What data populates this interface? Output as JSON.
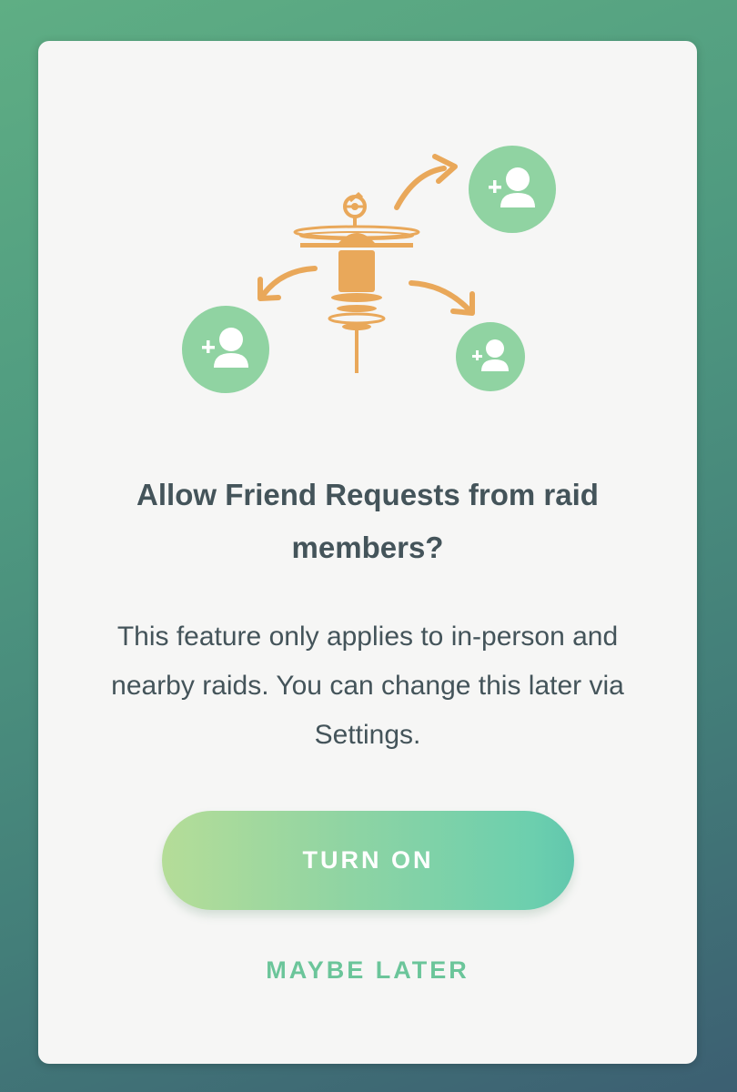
{
  "dialog": {
    "title": "Allow Friend Requests from raid members?",
    "body": "This feature only applies to in-person and nearby raids. You can change this later via Settings.",
    "primary_button": "TURN ON",
    "secondary_button": "MAYBE LATER"
  },
  "illustration": {
    "center_icon": "gym-icon",
    "friend_icons": [
      "add-friend-icon",
      "add-friend-icon",
      "add-friend-icon"
    ],
    "arrow_icons": [
      "arrow-icon",
      "arrow-icon",
      "arrow-icon"
    ]
  },
  "colors": {
    "background_start": "#5fae84",
    "background_end": "#3c5f72",
    "dialog_bg": "#f6f6f5",
    "text": "#44545a",
    "accent_green": "#6bc59a",
    "friend_circle": "#90d3a2",
    "gym_orange": "#e9a85a"
  }
}
